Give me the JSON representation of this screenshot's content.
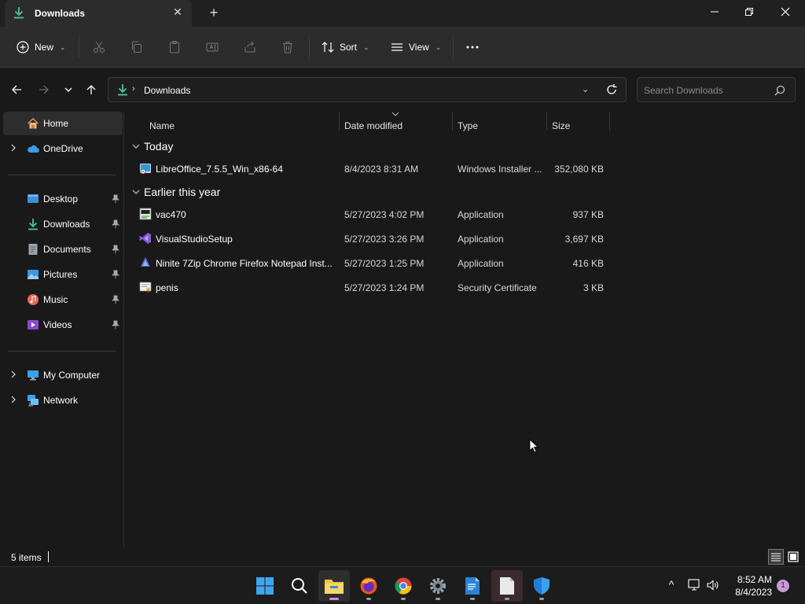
{
  "window": {
    "tab_title": "Downloads",
    "tab_close_glyph": "✕",
    "new_tab_glyph": "+"
  },
  "command_bar": {
    "new_label": "New",
    "sort_label": "Sort",
    "view_label": "View",
    "chevron_glyph": "⌄"
  },
  "address": {
    "separator_glyph": "›",
    "path": "Downloads",
    "dropdown_glyph": "⌄",
    "search_placeholder": "Search Downloads"
  },
  "sidebar": {
    "home": "Home",
    "onedrive": "OneDrive",
    "quick_access": [
      {
        "label": "Desktop",
        "icon": "desktop-icon"
      },
      {
        "label": "Downloads",
        "icon": "downloads-icon"
      },
      {
        "label": "Documents",
        "icon": "documents-icon"
      },
      {
        "label": "Pictures",
        "icon": "pictures-icon"
      },
      {
        "label": "Music",
        "icon": "music-icon"
      },
      {
        "label": "Videos",
        "icon": "videos-icon"
      }
    ],
    "my_computer": "My Computer",
    "network": "Network"
  },
  "columns": {
    "name": "Name",
    "date": "Date modified",
    "type": "Type",
    "size": "Size"
  },
  "groups": {
    "today": "Today",
    "earlier": "Earlier this year"
  },
  "files": [
    {
      "name": "LibreOffice_7.5.5_Win_x86-64",
      "date": "8/4/2023 8:31 AM",
      "type": "Windows Installer ...",
      "size": "352,080 KB",
      "icon": "msi-installer-icon"
    },
    {
      "name": "vac470",
      "date": "5/27/2023 4:02 PM",
      "type": "Application",
      "size": "937 KB",
      "icon": "application-icon"
    },
    {
      "name": "VisualStudioSetup",
      "date": "5/27/2023 3:26 PM",
      "type": "Application",
      "size": "3,697 KB",
      "icon": "visual-studio-icon"
    },
    {
      "name": "Ninite 7Zip Chrome Firefox Notepad Inst...",
      "date": "5/27/2023 1:25 PM",
      "type": "Application",
      "size": "416 KB",
      "icon": "ninite-icon"
    },
    {
      "name": "penis",
      "date": "5/27/2023 1:24 PM",
      "type": "Security Certificate",
      "size": "3 KB",
      "icon": "certificate-icon"
    }
  ],
  "status": {
    "item_count": "5 items"
  },
  "taskbar": {
    "time": "8:52 AM",
    "date": "8/4/2023",
    "notification_count": "1",
    "tray_chevron": "^"
  },
  "colors": {
    "accent_download": "#4cc2a2",
    "folder_yellow": "#f3c542",
    "notif_badge": "#c69ad5"
  }
}
